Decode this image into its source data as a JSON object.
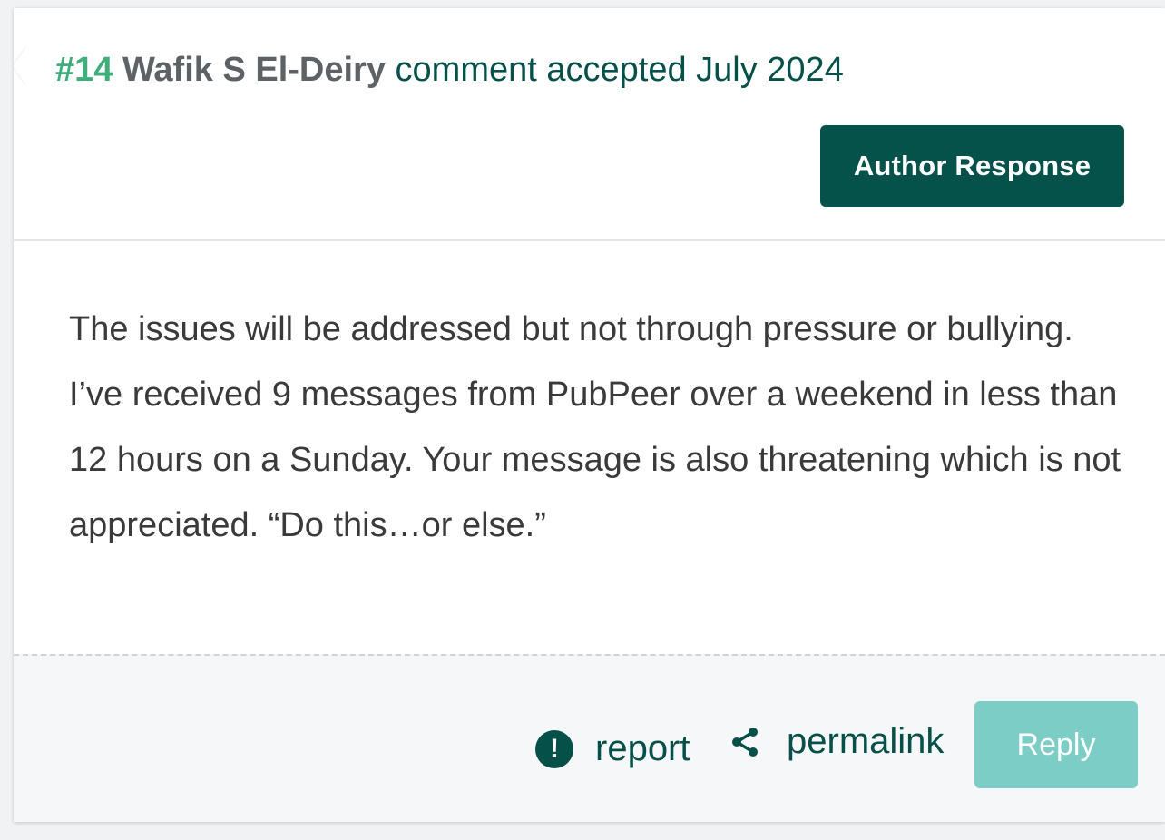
{
  "header": {
    "comment_number": "#14",
    "author_name": "Wafik S El-Deiry",
    "meta_text": "comment accepted July 2024"
  },
  "badge": {
    "label": "Author Response"
  },
  "comment": {
    "body": "The issues will be addressed but not through pressure or bullying. I’ve received 9 messages from PubPeer over a weekend in less than 12 hours on a Sunday. Your message is also threatening which is not appreciated. “Do this…or else.”"
  },
  "footer": {
    "report_label": "report",
    "permalink_label": "permalink",
    "reply_label": "Reply"
  },
  "icons": {
    "report": "exclamation-circle-icon",
    "permalink": "share-icon"
  },
  "colors": {
    "accent_dark_green": "#05524b",
    "comment_number_green": "#3fae7a",
    "reply_button": "#7ccdc6",
    "author_gray": "#5d6266"
  }
}
